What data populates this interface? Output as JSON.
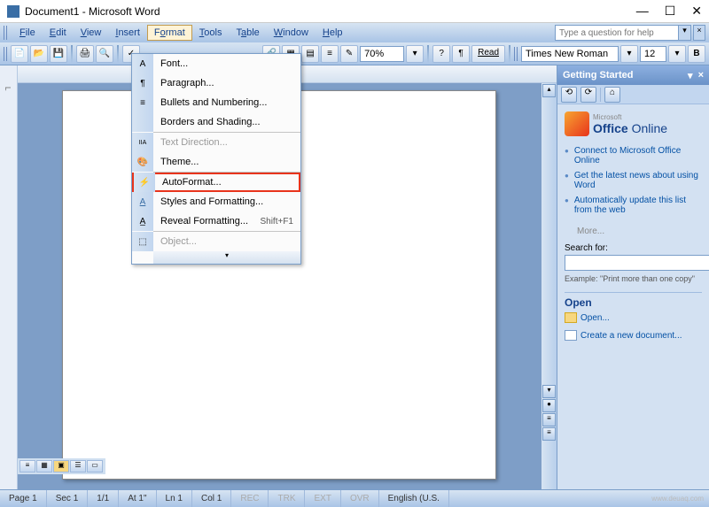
{
  "window": {
    "title": "Document1 - Microsoft Word",
    "min": "—",
    "max": "☐",
    "close": "✕"
  },
  "menubar": {
    "items": [
      "File",
      "Edit",
      "View",
      "Insert",
      "Format",
      "Tools",
      "Table",
      "Window",
      "Help"
    ],
    "active_index": 4,
    "help_placeholder": "Type a question for help"
  },
  "toolbar": {
    "zoom": "70%",
    "read": "Read",
    "font_name": "Times New Roman",
    "font_size": "12",
    "bold": "B"
  },
  "format_menu": {
    "items": [
      {
        "label": "Font...",
        "icon": "A",
        "enabled": true
      },
      {
        "label": "Paragraph...",
        "icon": "¶",
        "enabled": true
      },
      {
        "label": "Bullets and Numbering...",
        "icon": "≡",
        "enabled": true
      },
      {
        "label": "Borders and Shading...",
        "icon": "",
        "enabled": true
      },
      {
        "sep": true
      },
      {
        "label": "Text Direction...",
        "icon": "IIA",
        "enabled": false
      },
      {
        "label": "Theme...",
        "icon": "🎨",
        "enabled": true
      },
      {
        "sep": true
      },
      {
        "label": "AutoFormat...",
        "icon": "⚡",
        "enabled": true,
        "highlight": true
      },
      {
        "label": "Styles and Formatting...",
        "icon": "A",
        "enabled": true
      },
      {
        "label": "Reveal Formatting...",
        "shortcut": "Shift+F1",
        "icon": "A",
        "enabled": true
      },
      {
        "sep": true
      },
      {
        "label": "Object...",
        "icon": "⬚",
        "enabled": false
      }
    ]
  },
  "task_pane": {
    "title": "Getting Started",
    "office_brand": "Office Online",
    "office_prefix": "Microsoft",
    "links": [
      "Connect to Microsoft Office Online",
      "Get the latest news about using Word",
      "Automatically update this list from the web"
    ],
    "more": "More...",
    "search_label": "Search for:",
    "example": "Example: \"Print more than one copy\"",
    "open_heading": "Open",
    "open_link": "Open...",
    "create_link": "Create a new document..."
  },
  "statusbar": {
    "page": "Page 1",
    "sec": "Sec 1",
    "of": "1/1",
    "at": "At 1\"",
    "ln": "Ln 1",
    "col": "Col 1",
    "rec": "REC",
    "trk": "TRK",
    "ext": "EXT",
    "ovr": "OVR",
    "lang": "English (U.S."
  },
  "watermark": "www.deuaq.com"
}
